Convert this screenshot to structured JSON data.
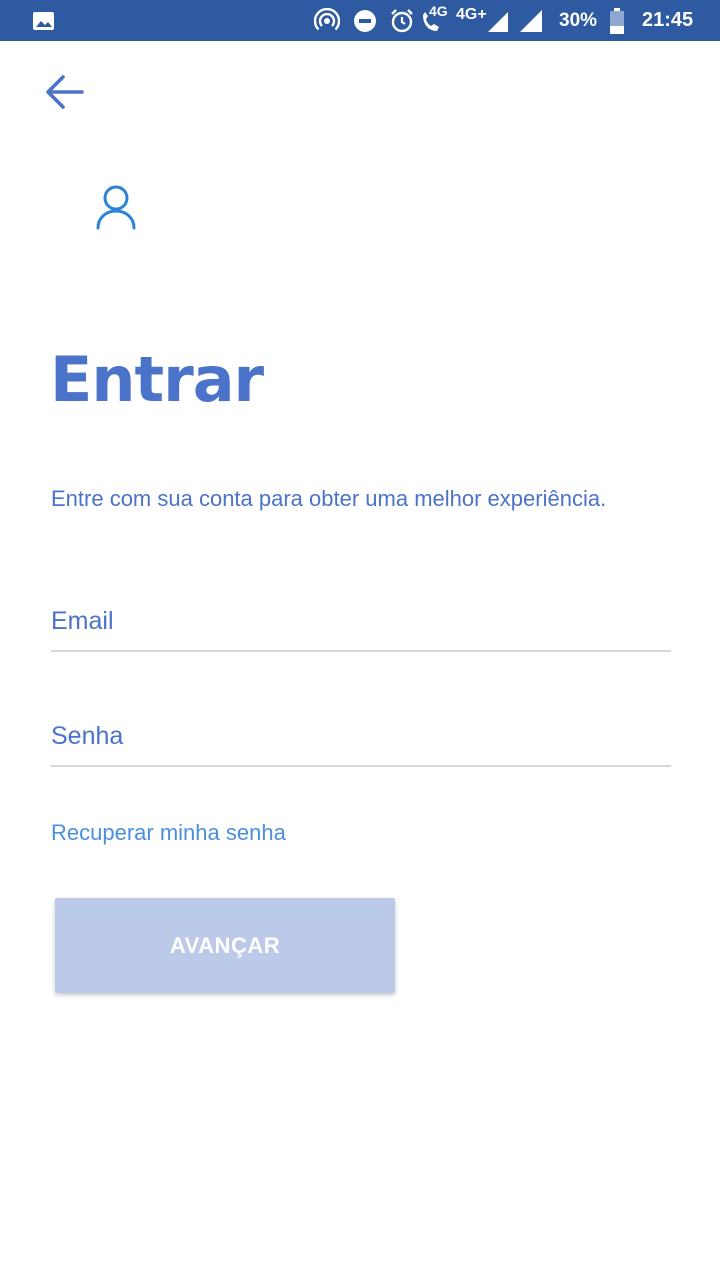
{
  "status_bar": {
    "network_4g_small": "4G",
    "network_4g_plus": "4G+",
    "battery_percent": "30%",
    "time": "21:45",
    "icons": [
      "image-icon",
      "hotspot-icon",
      "do-not-disturb-icon",
      "alarm-icon",
      "volte-call-icon",
      "signal-icon",
      "signal-icon",
      "battery-icon"
    ]
  },
  "header": {
    "back_icon": "arrow-left-icon",
    "user_icon": "user-icon",
    "accent_color": "#4b73c9"
  },
  "login": {
    "title": "Entrar",
    "subtitle": "Entre com sua conta para obter uma melhor experiência.",
    "email_placeholder": "Email",
    "password_placeholder": "Senha",
    "recover_label": "Recuperar minha senha",
    "submit_label": "AVANÇAR"
  }
}
